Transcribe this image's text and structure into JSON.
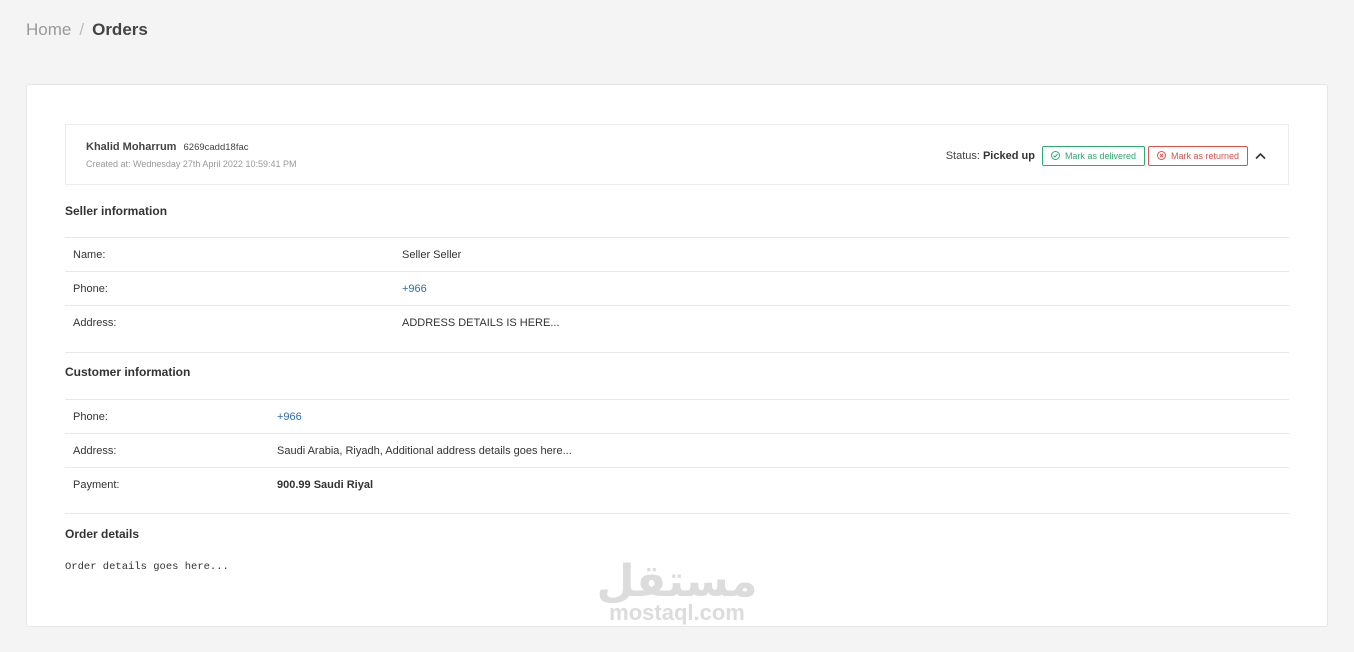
{
  "breadcrumb": {
    "home": "Home",
    "separator": "/",
    "current": "Orders"
  },
  "order": {
    "customer_name": "Khalid Moharrum",
    "order_id": "6269cadd18fac",
    "created_at": "Created at: Wednesday 27th April 2022 10:59:41 PM",
    "status_label": "Status:",
    "status_value": "Picked up",
    "mark_delivered_label": "Mark as delivered",
    "mark_returned_label": "Mark as returned",
    "collapse_icon": "chevron-up-icon"
  },
  "seller": {
    "title": "Seller information",
    "rows": [
      {
        "label": "Name:",
        "value": "Seller Seller"
      },
      {
        "label": "Phone:",
        "value": "+966"
      },
      {
        "label": "Address:",
        "value": "ADDRESS DETAILS IS HERE..."
      }
    ]
  },
  "customer": {
    "title": "Customer information",
    "rows": [
      {
        "label": "Phone:",
        "value": "+966"
      },
      {
        "label": "Address:",
        "value": "Saudi Arabia, Riyadh, Additional address details goes here..."
      },
      {
        "label": "Payment:",
        "value": "900.99 Saudi Riyal"
      }
    ]
  },
  "order_details": {
    "title": "Order details",
    "text": "Order details goes here..."
  },
  "watermark": {
    "arabic": "مستقل",
    "latin": "mostaql.com"
  },
  "colors": {
    "success": "#2eaa72",
    "danger": "#d9534f",
    "link": "#2a6fa8",
    "background": "#f4f4f4"
  }
}
